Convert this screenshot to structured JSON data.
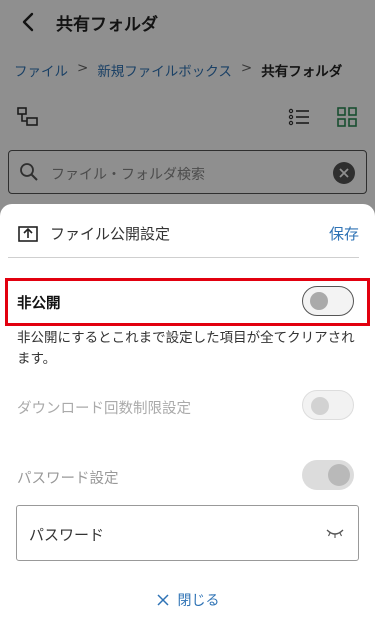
{
  "header": {
    "title": "共有フォルダ"
  },
  "breadcrumb": {
    "items": [
      "ファイル",
      "新規ファイルボックス"
    ],
    "separator": ">",
    "current": "共有フォルダ"
  },
  "search": {
    "placeholder": "ファイル・フォルダ検索"
  },
  "sheet": {
    "title": "ファイル公開設定",
    "save_label": "保存",
    "private": {
      "label": "非公開",
      "enabled": false,
      "description": "非公開にするとこれまで設定した項目が全てクリアされます。"
    },
    "download_limit": {
      "label": "ダウンロード回数制限設定",
      "enabled": false
    },
    "password": {
      "label": "パスワード設定",
      "enabled": true,
      "placeholder": "パスワード"
    },
    "close_label": "閉じる"
  },
  "colors": {
    "accent": "#2f73b5",
    "highlight": "#e2000f",
    "grid_icon": "#2e8b57"
  }
}
